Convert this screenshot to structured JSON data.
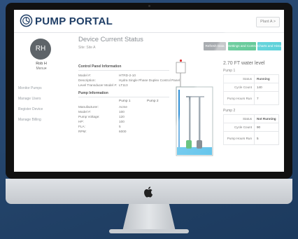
{
  "app": {
    "logo_text": "PUMP PORTAL",
    "plant_selector": "Plant A >"
  },
  "user": {
    "initials": "RH",
    "name": "Rob H",
    "menu_label": "Menu▾"
  },
  "nav": {
    "items": [
      {
        "label": "Monitor Pumps"
      },
      {
        "label": "Manage Users"
      },
      {
        "label": "Register Device"
      },
      {
        "label": "Manage Billing"
      }
    ]
  },
  "page": {
    "title": "Device Current Status",
    "subtitle": "Site: Site A"
  },
  "buttons": {
    "refresh": "Refresh Data",
    "settings": "Settings and Control",
    "charts": "Charts and History"
  },
  "control_panel": {
    "heading": "Control Panel Information",
    "rows": [
      {
        "key": "Model #:",
        "value": "HTRD-2-10"
      },
      {
        "key": "Description:",
        "value": "Hydra Single Phase Duplex Control Panel"
      },
      {
        "key": "Level Transducer Model #:",
        "value": "LT113"
      }
    ]
  },
  "pump_info": {
    "heading": "Pump Information",
    "col1": "Pump 1",
    "col2": "Pump 2",
    "rows": [
      {
        "key": "Manufacturer:",
        "value": "Acme"
      },
      {
        "key": "Model #:",
        "value": "100"
      },
      {
        "key": "Pump Voltage:",
        "value": "120"
      },
      {
        "key": "HP:",
        "value": "100"
      },
      {
        "key": "FLA:",
        "value": "5"
      },
      {
        "key": "RPM:",
        "value": "6000"
      }
    ]
  },
  "status": {
    "water_level": "2.70 FT water level",
    "pump1": {
      "label": "Pump 1",
      "status_key": "Status",
      "status_value": "Running",
      "cycle_key": "Cycle Count",
      "cycle_value": "140",
      "hours_key": "Pump Hours Run",
      "hours_value": "7"
    },
    "pump2": {
      "label": "Pump 2",
      "status_key": "Status",
      "status_value": "Not Running",
      "cycle_key": "Cycle Count",
      "cycle_value": "90",
      "hours_key": "Pump Hours Run",
      "hours_value": "5"
    }
  },
  "colors": {
    "settings_button": "#2bb673",
    "charts_button": "#30c5cf",
    "refresh_button": "#a8acb0",
    "logo": "#1f3e66",
    "water": "#2f8fd6",
    "pump_green": "#2aa84a"
  }
}
